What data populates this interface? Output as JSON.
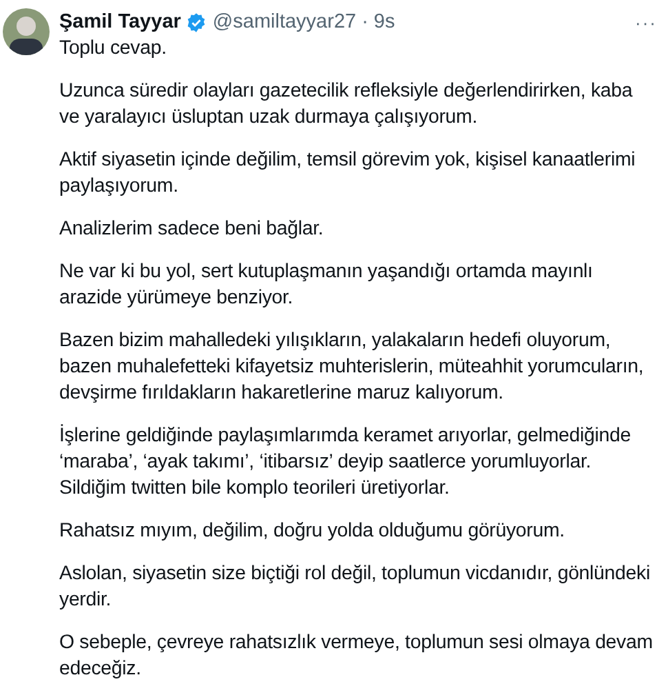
{
  "author": {
    "name": "Şamil Tayyar",
    "verified": true,
    "handle": "@samiltayyar27",
    "separator": "·",
    "time": "9s"
  },
  "more": "···",
  "paragraphs": [
    "Toplu cevap.",
    "Uzunca süredir olayları gazetecilik refleksiyle değerlendirirken, kaba ve yaralayıcı üsluptan uzak durmaya çalışıyorum.",
    "Aktif siyasetin içinde değilim, temsil görevim yok, kişisel kanaatlerimi paylaşıyorum.",
    "Analizlerim sadece beni bağlar.",
    "Ne var ki bu yol, sert kutuplaşmanın yaşandığı ortamda mayınlı arazide yürümeye benziyor.",
    "Bazen bizim mahalledeki yılışıkların, yalakaların hedefi oluyorum, bazen muhalefetteki kifayetsiz muhterislerin, müteahhit yorumcuların, devşirme fırıldakların hakaretlerine maruz kalıyorum.",
    "İşlerine geldiğinde paylaşımlarımda keramet arıyorlar, gelmediğinde ‘maraba’, ‘ayak takımı’, ‘itibarsız’ deyip saatlerce yorumluyorlar. Sildiğim twitten bile komplo teorileri üretiyorlar.",
    "Rahatsız mıyım, değilim, doğru yolda olduğumu görüyorum.",
    "Aslolan, siyasetin size biçtiği rol değil, toplumun vicdanıdır, gönlündeki yerdir.",
    "O sebeple, çevreye rahatsızlık vermeye, toplumun sesi olmaya devam edeceğiz."
  ]
}
